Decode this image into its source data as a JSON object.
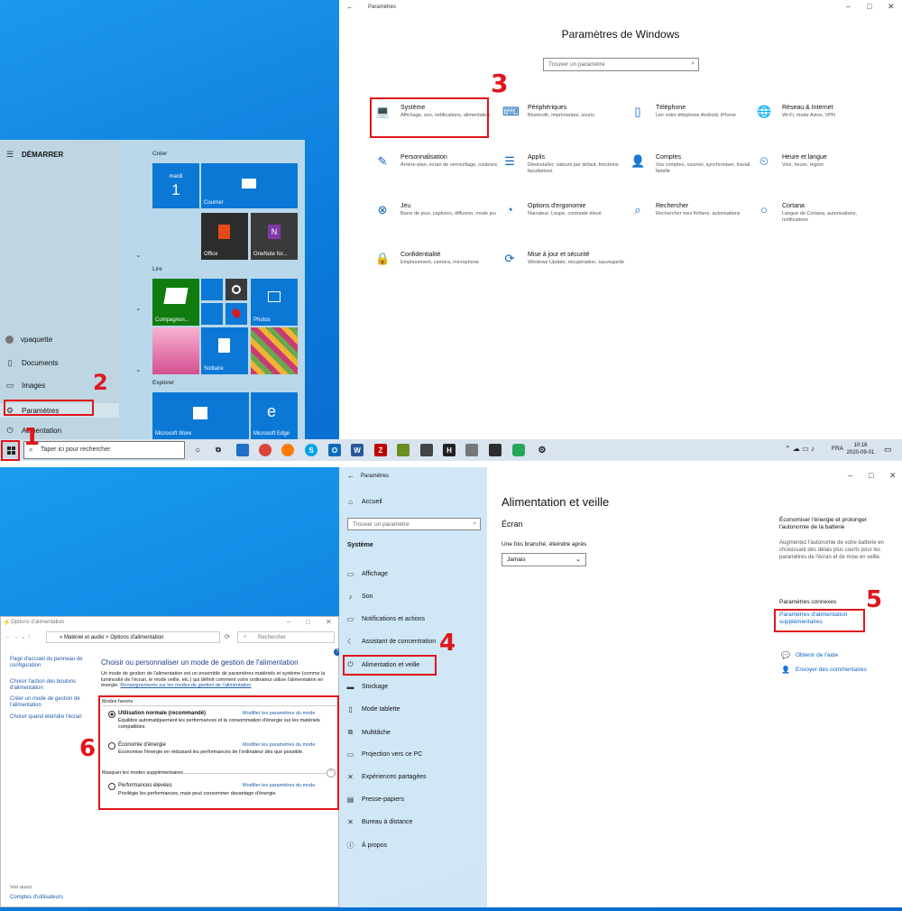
{
  "start_menu": {
    "header": "DÉMARRER",
    "user": "vpaquette",
    "items": [
      "Documents",
      "Images",
      "Paramètres",
      "Alimentation"
    ],
    "groups": [
      "Créer",
      "Lire",
      "Explorer"
    ],
    "calendar": {
      "day": "mardi",
      "date": "1"
    },
    "tiles": [
      "Courrier",
      "Office",
      "OneNote for...",
      "Compagnon...",
      "Photos",
      "Solitaire",
      "Microsoft Store",
      "Microsoft Edge"
    ]
  },
  "taskbar": {
    "search_placeholder": "Taper ici pour rechercher",
    "lang": "FRA",
    "time": "10:16",
    "date": "2020-09-01"
  },
  "settings": {
    "title": "Paramètres",
    "heading": "Paramètres de Windows",
    "search_placeholder": "Trouver un paramètre",
    "items": [
      {
        "title": "Système",
        "desc": "Affichage, son, notifications, alimentation",
        "icon": "laptop-icon"
      },
      {
        "title": "Périphériques",
        "desc": "Bluetooth, imprimantes, souris",
        "icon": "keyboard-icon"
      },
      {
        "title": "Téléphone",
        "desc": "Lier votre téléphone Android, iPhone",
        "icon": "phone-icon"
      },
      {
        "title": "Réseau & Internet",
        "desc": "Wi-Fi, mode Avion, VPN",
        "icon": "globe-icon"
      },
      {
        "title": "Personnalisation",
        "desc": "Arrière-plan, écran de verrouillage, couleurs",
        "icon": "paintbrush-icon"
      },
      {
        "title": "Applis",
        "desc": "Désinstaller, valeurs par défaut, fonctions facultatives",
        "icon": "apps-list-icon"
      },
      {
        "title": "Comptes",
        "desc": "Vos comptes, courriel, synchroniser, travail, famille",
        "icon": "person-icon"
      },
      {
        "title": "Heure et langue",
        "desc": "Voix, heure, région",
        "icon": "clock-language-icon"
      },
      {
        "title": "Jeu",
        "desc": "Barre de jeux, captures, diffusion, mode jeu",
        "icon": "xbox-icon"
      },
      {
        "title": "Options d'ergonomie",
        "desc": "Narrateur, Loupe, contraste élevé",
        "icon": "ease-of-access-icon"
      },
      {
        "title": "Rechercher",
        "desc": "Rechercher mes fichiers, autorisations",
        "icon": "search-icon"
      },
      {
        "title": "Cortana",
        "desc": "Langue de Cortana, autorisations, notifications",
        "icon": "cortana-icon"
      },
      {
        "title": "Confidentialité",
        "desc": "Emplacement, caméra, microphone",
        "icon": "lock-icon"
      },
      {
        "title": "Mise à jour et sécurité",
        "desc": "Windows Update, récupération, sauvegarde",
        "icon": "update-icon"
      }
    ]
  },
  "power_options": {
    "title": "Options d'alimentation",
    "breadcrumb_1": "«",
    "breadcrumb_2": "Matériel et audio",
    "breadcrumb_sep": ">",
    "breadcrumb_3": "Options d'alimentation",
    "search_placeholder": "Rechercher",
    "left_links": [
      "Page d'accueil du panneau de configuration",
      "Choisir l'action des boutons d'alimentation",
      "Créer un mode de gestion de l'alimentation",
      "Choisir quand éteindre l'écran"
    ],
    "see_also": "Voir aussi",
    "see_also_link": "Comptes d'utilisateurs",
    "heading": "Choisir ou personnaliser un mode de gestion de l'alimentation",
    "intro": "Un mode de gestion de l'alimentation est un ensemble de paramètres matériels et système (comme la luminosité de l'écran, le mode veille, etc.) qui définit comment votre ordinateur utilise l'alimentation en énergie.",
    "intro_link": "Renseignements sur les modes de gestion de l'alimentation",
    "favorites_label": "Modes favoris",
    "plans": [
      {
        "name": "Utilisation normale (recommandé)",
        "desc": "Équilibre automatiquement les performances et la consommation d'énergie sur les matériels compatibles.",
        "selected": true
      },
      {
        "name": "Économie d'énergie",
        "desc": "Économise l'énergie en réduisant les performances de l'ordinateur dès que possible.",
        "selected": false
      }
    ],
    "hidden_label": "Masquer les modes supplémentaires",
    "extra_plan": {
      "name": "Performances élevées",
      "desc": "Privilégie les performances, mais peut consommer davantage d'énergie.",
      "selected": false
    },
    "modify_link": "Modifier les paramètres du mode"
  },
  "settings2": {
    "title": "Paramètres",
    "home": "Accueil",
    "search_placeholder": "Trouver un paramètre",
    "section": "Système",
    "nav": [
      "Affichage",
      "Son",
      "Notifications et actions",
      "Assistant de concentration",
      "Alimentation et veille",
      "Stockage",
      "Mode tablette",
      "Multitâche",
      "Projection vers ce PC",
      "Expériences partagées",
      "Presse-papiers",
      "Bureau à distance",
      "À propos"
    ],
    "page_title": "Alimentation et veille",
    "screen_heading": "Écran",
    "plugged_label": "Une fois branché, éteindre après",
    "plugged_value": "Jamais",
    "side_heading": "Économiser l'énergie et prolonger l'autonomie de la batterie",
    "side_text": "Augmentez l'autonomie de votre batterie en choisissant des délais plus courts pour les paramètres de l'écran et de mise en veille.",
    "related_heading": "Paramètres connexes",
    "related_link": "Paramètres d'alimentation supplémentaires",
    "help_link": "Obtenir de l'aide",
    "feedback_link": "Envoyer des commentaires"
  },
  "step_numbers": [
    "1",
    "2",
    "3",
    "4",
    "5",
    "6"
  ],
  "colors": {
    "accent": "#0c78d6",
    "highlight": "#e0151b",
    "link": "#1e5aa8"
  }
}
